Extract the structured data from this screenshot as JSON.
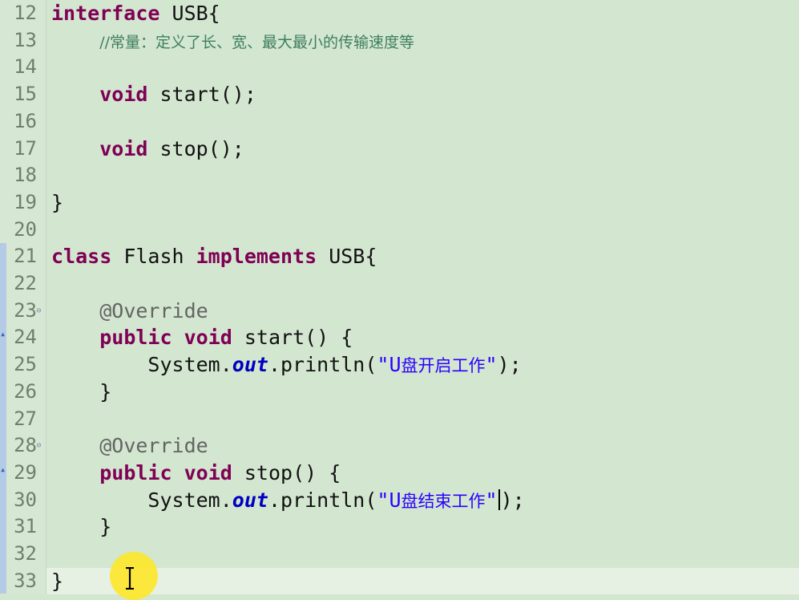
{
  "editor": {
    "lines": [
      {
        "num": "12",
        "tokens": [
          {
            "t": "interface",
            "c": "kw"
          },
          {
            "t": " USB{",
            "c": ""
          }
        ]
      },
      {
        "num": "13",
        "tokens": [
          {
            "t": "    ",
            "c": ""
          },
          {
            "t": "//常量：定义了长、宽、最大最小的传输速度等",
            "c": "cmt"
          }
        ]
      },
      {
        "num": "14",
        "tokens": []
      },
      {
        "num": "15",
        "tokens": [
          {
            "t": "    ",
            "c": ""
          },
          {
            "t": "void",
            "c": "kw"
          },
          {
            "t": " start();",
            "c": ""
          }
        ]
      },
      {
        "num": "16",
        "tokens": []
      },
      {
        "num": "17",
        "tokens": [
          {
            "t": "    ",
            "c": ""
          },
          {
            "t": "void",
            "c": "kw"
          },
          {
            "t": " stop();",
            "c": ""
          }
        ]
      },
      {
        "num": "18",
        "tokens": []
      },
      {
        "num": "19",
        "tokens": [
          {
            "t": "}",
            "c": ""
          }
        ]
      },
      {
        "num": "20",
        "tokens": []
      },
      {
        "num": "21",
        "tokens": [
          {
            "t": "class",
            "c": "kw"
          },
          {
            "t": " Flash ",
            "c": ""
          },
          {
            "t": "implements",
            "c": "kw"
          },
          {
            "t": " USB{",
            "c": ""
          }
        ]
      },
      {
        "num": "22",
        "tokens": []
      },
      {
        "num": "23",
        "fold": "⊖",
        "tokens": [
          {
            "t": "    ",
            "c": ""
          },
          {
            "t": "@Override",
            "c": "ann"
          }
        ]
      },
      {
        "num": "24",
        "override": "▴",
        "tokens": [
          {
            "t": "    ",
            "c": ""
          },
          {
            "t": "public",
            "c": "kw"
          },
          {
            "t": " ",
            "c": ""
          },
          {
            "t": "void",
            "c": "kw"
          },
          {
            "t": " start() {",
            "c": ""
          }
        ]
      },
      {
        "num": "25",
        "tokens": [
          {
            "t": "        System.",
            "c": ""
          },
          {
            "t": "out",
            "c": "field"
          },
          {
            "t": ".println(",
            "c": ""
          },
          {
            "t": "\"U盘开启工作\"",
            "c": "str"
          },
          {
            "t": ");",
            "c": ""
          }
        ]
      },
      {
        "num": "26",
        "tokens": [
          {
            "t": "    }",
            "c": ""
          }
        ]
      },
      {
        "num": "27",
        "tokens": []
      },
      {
        "num": "28",
        "fold": "⊖",
        "tokens": [
          {
            "t": "    ",
            "c": ""
          },
          {
            "t": "@Override",
            "c": "ann"
          }
        ]
      },
      {
        "num": "29",
        "override": "▴",
        "tokens": [
          {
            "t": "    ",
            "c": ""
          },
          {
            "t": "public",
            "c": "kw"
          },
          {
            "t": " ",
            "c": ""
          },
          {
            "t": "void",
            "c": "kw"
          },
          {
            "t": " stop() {",
            "c": ""
          }
        ]
      },
      {
        "num": "30",
        "caret": true,
        "tokens": [
          {
            "t": "        System.",
            "c": ""
          },
          {
            "t": "out",
            "c": "field"
          },
          {
            "t": ".println(",
            "c": ""
          },
          {
            "t": "\"U盘结束工作\"",
            "c": "str"
          },
          {
            "t": "CARET",
            "c": "caret"
          },
          {
            "t": ");",
            "c": ""
          }
        ]
      },
      {
        "num": "31",
        "tokens": [
          {
            "t": "    }",
            "c": ""
          }
        ]
      },
      {
        "num": "32",
        "tokens": []
      },
      {
        "num": "33",
        "current": true,
        "tokens": [
          {
            "t": "}",
            "c": ""
          }
        ]
      }
    ]
  },
  "colors": {
    "background": "#d3e6d0",
    "keyword": "#7f0055",
    "string": "#2a00ff",
    "comment": "#3f7f5f",
    "annotation": "#646464",
    "field": "#0000c0"
  },
  "cursor": {
    "icon": "text-ibeam-cursor-icon"
  }
}
